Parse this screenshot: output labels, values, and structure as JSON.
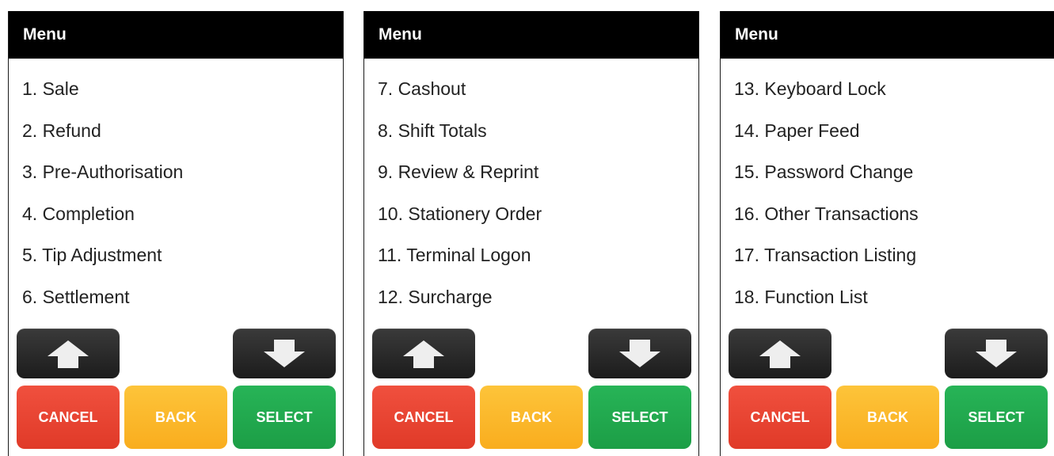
{
  "colors": {
    "header_bg": "#000000",
    "arrow_button": "#2a2a2a",
    "cancel": "#e8432f",
    "back": "#fbb829",
    "select": "#22aa50"
  },
  "icons": {
    "up": "up-arrow-icon",
    "down": "down-arrow-icon"
  },
  "screens": [
    {
      "title": "Menu",
      "items": [
        "1. Sale",
        "2. Refund",
        "3. Pre-Authorisation",
        "4. Completion",
        "5. Tip Adjustment",
        "6. Settlement"
      ],
      "buttons": {
        "cancel": "CANCEL",
        "back": "BACK",
        "select": "SELECT"
      }
    },
    {
      "title": "Menu",
      "items": [
        "7. Cashout",
        "8. Shift Totals",
        "9. Review & Reprint",
        "10. Stationery Order",
        "11. Terminal Logon",
        "12. Surcharge"
      ],
      "buttons": {
        "cancel": "CANCEL",
        "back": "BACK",
        "select": "SELECT"
      }
    },
    {
      "title": "Menu",
      "items": [
        "13. Keyboard Lock",
        "14. Paper Feed",
        "15. Password Change",
        "16. Other Transactions",
        "17. Transaction Listing",
        "18. Function List"
      ],
      "buttons": {
        "cancel": "CANCEL",
        "back": "BACK",
        "select": "SELECT"
      }
    }
  ]
}
